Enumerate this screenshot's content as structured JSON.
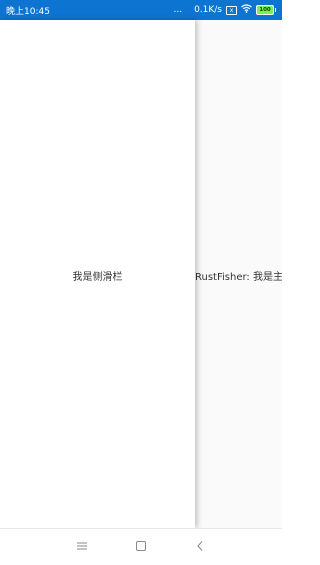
{
  "status_bar": {
    "time": "晚上10:45",
    "more": "...",
    "network_speed": "0.1K/s",
    "sim_icon": "x",
    "battery_level": "100",
    "background_color": "#0d74d1"
  },
  "drawer": {
    "text": "我是侧滑栏"
  },
  "main": {
    "text": "RustFisher: 我是主"
  },
  "nav_bar": {
    "menu_icon": "menu-icon",
    "home_icon": "square-icon",
    "back_icon": "back-icon"
  }
}
